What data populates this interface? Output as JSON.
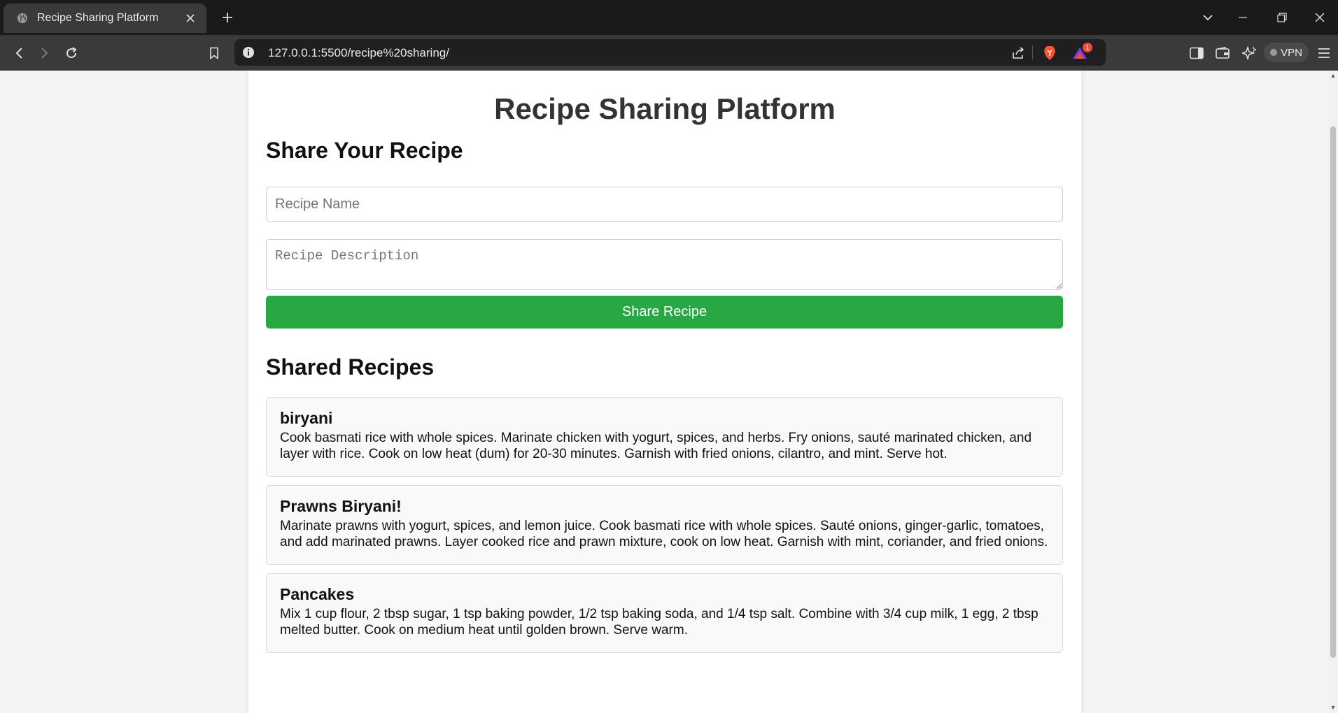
{
  "browser": {
    "tab_title": "Recipe Sharing Platform",
    "url": "127.0.0.1:5500/recipe%20sharing/",
    "vpn_label": "VPN",
    "rewards_badge": "1",
    "colors": {
      "tabstrip": "#1a1a1c",
      "toolbar": "#3a3a3d",
      "omnibox": "#1f1f21",
      "brave_orange": "#fb542b",
      "rewards_red": "#f0493e"
    },
    "icons": [
      "globe-icon",
      "close-icon",
      "plus-icon",
      "chevron-down-icon",
      "minimize-icon",
      "restore-icon",
      "back-icon",
      "forward-icon",
      "reload-icon",
      "bookmark-icon",
      "info-icon",
      "share-icon",
      "brave-shields-icon",
      "brave-rewards-icon",
      "sidebar-icon",
      "wallet-icon",
      "leo-ai-icon",
      "menu-icon"
    ]
  },
  "page": {
    "title": "Recipe Sharing Platform",
    "share_heading": "Share Your Recipe",
    "form": {
      "name_placeholder": "Recipe Name",
      "name_value": "",
      "description_placeholder": "Recipe Description",
      "description_value": "",
      "submit_label": "Share Recipe"
    },
    "shared_heading": "Shared Recipes",
    "recipes": [
      {
        "name": "biryani",
        "description": "Cook basmati rice with whole spices. Marinate chicken with yogurt, spices, and herbs. Fry onions, sauté marinated chicken, and layer with rice. Cook on low heat (dum) for 20-30 minutes. Garnish with fried onions, cilantro, and mint. Serve hot."
      },
      {
        "name": "Prawns Biryani!",
        "description": "Marinate prawns with yogurt, spices, and lemon juice. Cook basmati rice with whole spices. Sauté onions, ginger-garlic, tomatoes, and add marinated prawns. Layer cooked rice and prawn mixture, cook on low heat. Garnish with mint, coriander, and fried onions."
      },
      {
        "name": "Pancakes",
        "description": "Mix 1 cup flour, 2 tbsp sugar, 1 tsp baking powder, 1/2 tsp baking soda, and 1/4 tsp salt. Combine with 3/4 cup milk, 1 egg, 2 tbsp melted butter. Cook on medium heat until golden brown. Serve warm."
      }
    ],
    "colors": {
      "button": "#28a745",
      "title": "#333333",
      "card_bg": "#f9f9f9",
      "page_bg": "#f4f4f4"
    }
  }
}
